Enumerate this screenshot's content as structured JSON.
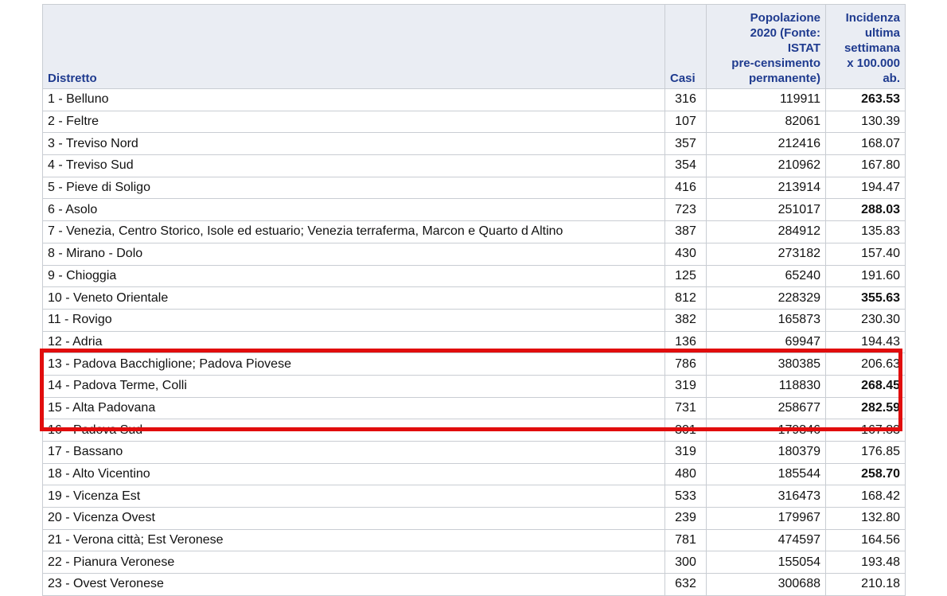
{
  "table": {
    "headers": {
      "district": "Distretto",
      "cases": "Casi",
      "population_lines": [
        "Popolazione",
        "2020 (Fonte:",
        "ISTAT",
        "pre-censimento",
        "permanente)"
      ],
      "incidence_lines": [
        "Incidenza",
        "ultima",
        "settimana",
        "x 100.000",
        "ab."
      ]
    },
    "rows": [
      {
        "district": "1 - Belluno",
        "cases": "316",
        "population": "119911",
        "incidence": "263.53",
        "bold": true
      },
      {
        "district": "2 - Feltre",
        "cases": "107",
        "population": "82061",
        "incidence": "130.39",
        "bold": false
      },
      {
        "district": "3 - Treviso Nord",
        "cases": "357",
        "population": "212416",
        "incidence": "168.07",
        "bold": false
      },
      {
        "district": "4 - Treviso Sud",
        "cases": "354",
        "population": "210962",
        "incidence": "167.80",
        "bold": false
      },
      {
        "district": "5 - Pieve di Soligo",
        "cases": "416",
        "population": "213914",
        "incidence": "194.47",
        "bold": false
      },
      {
        "district": "6 - Asolo",
        "cases": "723",
        "population": "251017",
        "incidence": "288.03",
        "bold": true
      },
      {
        "district": "7 - Venezia, Centro Storico, Isole ed estuario; Venezia terraferma, Marcon e Quarto d Altino",
        "cases": "387",
        "population": "284912",
        "incidence": "135.83",
        "bold": false
      },
      {
        "district": "8 - Mirano - Dolo",
        "cases": "430",
        "population": "273182",
        "incidence": "157.40",
        "bold": false
      },
      {
        "district": "9 - Chioggia",
        "cases": "125",
        "population": "65240",
        "incidence": "191.60",
        "bold": false
      },
      {
        "district": "10 - Veneto Orientale",
        "cases": "812",
        "population": "228329",
        "incidence": "355.63",
        "bold": true
      },
      {
        "district": "11 - Rovigo",
        "cases": "382",
        "population": "165873",
        "incidence": "230.30",
        "bold": false
      },
      {
        "district": "12 - Adria",
        "cases": "136",
        "population": "69947",
        "incidence": "194.43",
        "bold": false
      },
      {
        "district": "13 - Padova Bacchiglione; Padova Piovese",
        "cases": "786",
        "population": "380385",
        "incidence": "206.63",
        "bold": false
      },
      {
        "district": "14 - Padova Terme, Colli",
        "cases": "319",
        "population": "118830",
        "incidence": "268.45",
        "bold": true
      },
      {
        "district": "15 - Alta Padovana",
        "cases": "731",
        "population": "258677",
        "incidence": "282.59",
        "bold": true
      },
      {
        "district": "16 - Padova Sud",
        "cases": "301",
        "population": "179346",
        "incidence": "167.83",
        "bold": false
      },
      {
        "district": "17 - Bassano",
        "cases": "319",
        "population": "180379",
        "incidence": "176.85",
        "bold": false
      },
      {
        "district": "18 - Alto Vicentino",
        "cases": "480",
        "population": "185544",
        "incidence": "258.70",
        "bold": true
      },
      {
        "district": "19 - Vicenza Est",
        "cases": "533",
        "population": "316473",
        "incidence": "168.42",
        "bold": false
      },
      {
        "district": "20 - Vicenza Ovest",
        "cases": "239",
        "population": "179967",
        "incidence": "132.80",
        "bold": false
      },
      {
        "district": "21 - Verona città; Est Veronese",
        "cases": "781",
        "population": "474597",
        "incidence": "164.56",
        "bold": false
      },
      {
        "district": "22 - Pianura Veronese",
        "cases": "300",
        "population": "155054",
        "incidence": "193.48",
        "bold": false
      },
      {
        "district": "23 - Ovest Veronese",
        "cases": "632",
        "population": "300688",
        "incidence": "210.18",
        "bold": false
      }
    ]
  },
  "highlight": {
    "rows": [
      13,
      14,
      15,
      16
    ],
    "color": "#e10d0d"
  },
  "colors": {
    "header_bg": "#eaedf3",
    "header_text": "#1f3b8f",
    "grid": "#c9cdd3"
  }
}
